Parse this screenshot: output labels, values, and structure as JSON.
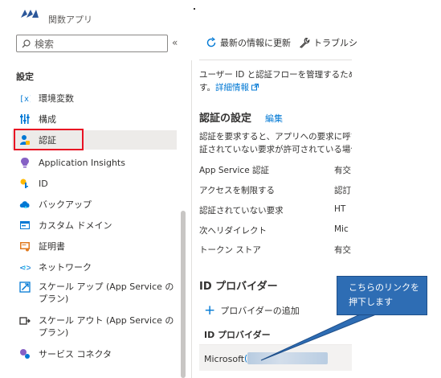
{
  "header": {
    "subtitle": "関数アプリ"
  },
  "sidebar": {
    "search_placeholder": "検索",
    "collapse": "«",
    "section_title": "設定",
    "items": [
      {
        "label": "環境変数",
        "icon": "env-variables-icon"
      },
      {
        "label": "構成",
        "icon": "configuration-icon"
      },
      {
        "label": "認証",
        "icon": "authentication-icon",
        "active": true
      },
      {
        "label": "Application Insights",
        "icon": "app-insights-icon"
      },
      {
        "label": "ID",
        "icon": "identity-icon"
      },
      {
        "label": "バックアップ",
        "icon": "backup-icon"
      },
      {
        "label": "カスタム ドメイン",
        "icon": "custom-domain-icon"
      },
      {
        "label": "証明書",
        "icon": "certificate-icon"
      },
      {
        "label": "ネットワーク",
        "icon": "network-icon"
      },
      {
        "label": "スケール アップ (App Service のプラン)",
        "icon": "scale-up-icon"
      },
      {
        "label": "スケール アウト (App Service のプラン)",
        "icon": "scale-out-icon"
      },
      {
        "label": "サービス コネクタ",
        "icon": "service-connector-icon"
      }
    ]
  },
  "toolbar": {
    "refresh_label": "最新の情報に更新",
    "troubleshoot_label": "トラブルシ"
  },
  "main": {
    "description_line1": "ユーザー ID と認証フローを管理するための",
    "description_line2_prefix": "す。",
    "details_link": "詳細情報",
    "auth_settings_heading": "認証の設定",
    "edit_link": "編集",
    "auth_desc_line1": "認証を要求すると、アプリへの要求に呼び出",
    "auth_desc_line2": "証されていない要求が許可されている場合、",
    "settings_rows": [
      {
        "key": "App Service 認証",
        "value": "有交"
      },
      {
        "key": "アクセスを制限する",
        "value": "認訂"
      },
      {
        "key": "認証されていない要求",
        "value": "HT"
      },
      {
        "key": "次へリダイレクト",
        "value": "Mic"
      },
      {
        "key": "トークン ストア",
        "value": "有交"
      }
    ],
    "idp_heading": "ID プロバイダー",
    "add_idp_label": "プロバイダーの追加",
    "idp_column_header": "ID プロバイダー",
    "provider_name": "Microsoft",
    "provider_paren": "("
  },
  "callout": {
    "line1": "こちらのリンクを",
    "line2": "押下します"
  },
  "colors": {
    "accent": "#0078d4",
    "highlight_border": "#e81123",
    "callout_bg": "#2e6db4"
  }
}
